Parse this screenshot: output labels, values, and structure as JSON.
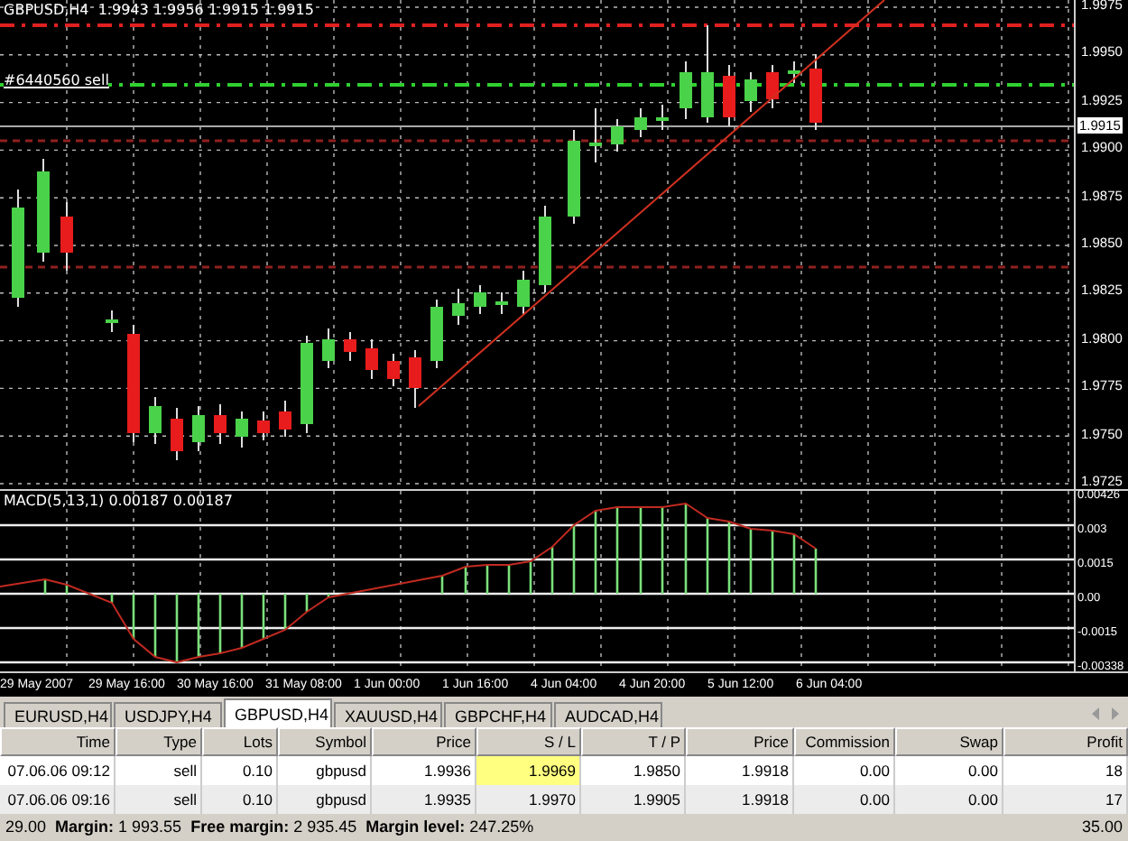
{
  "chart": {
    "header": "GBPUSD,H4  1.9943 1.9956 1.9915 1.9915",
    "order_label": "#6440560 sell",
    "current_price": "1.9915",
    "price_axis": [
      "1.9975",
      "1.9950",
      "1.9925",
      "1.9900",
      "1.9875",
      "1.9850",
      "1.9825",
      "1.9800",
      "1.9775",
      "1.9750",
      "1.9725"
    ]
  },
  "indicator": {
    "title": "MACD(5,13,1) 0.00187 0.00187",
    "axis": [
      "0.00426",
      "0.003",
      "0.0015",
      "0.00",
      "-0.0015",
      "-0.00338"
    ]
  },
  "time_axis": [
    "29 May 2007",
    "29 May 16:00",
    "30 May 16:00",
    "31 May 08:00",
    "1 Jun 00:00",
    "1 Jun 16:00",
    "4 Jun 04:00",
    "4 Jun 20:00",
    "5 Jun 12:00",
    "6 Jun 04:00"
  ],
  "tabs": [
    {
      "label": "EURUSD,H4",
      "selected": false
    },
    {
      "label": "USDJPY,H4",
      "selected": false
    },
    {
      "label": "GBPUSD,H4",
      "selected": true
    },
    {
      "label": "XAUUSD,H4",
      "selected": false
    },
    {
      "label": "GBPCHF,H4",
      "selected": false
    },
    {
      "label": "AUDCAD,H4",
      "selected": false
    }
  ],
  "table": {
    "columns": [
      "Time",
      "Type",
      "Lots",
      "Symbol",
      "Price",
      "S / L",
      "T / P",
      "Price",
      "Commission",
      "Swap",
      "Profit"
    ],
    "rows": [
      {
        "cells": [
          "07.06.06 09:12",
          "sell",
          "0.10",
          "gbpusd",
          "1.9936",
          "1.9969",
          "1.9850",
          "1.9918",
          "0.00",
          "0.00",
          "18"
        ],
        "sl_highlighted": true
      },
      {
        "cells": [
          "07.06.06 09:16",
          "sell",
          "0.10",
          "gbpusd",
          "1.9935",
          "1.9970",
          "1.9905",
          "1.9918",
          "0.00",
          "0.00",
          "17"
        ],
        "sl_highlighted": false
      }
    ]
  },
  "footer": {
    "summary": "29.00  **Margin:** 1 993.55  **Free margin:** 2 935.45  **Margin level:** 247.25%",
    "profit": "35.00"
  }
}
